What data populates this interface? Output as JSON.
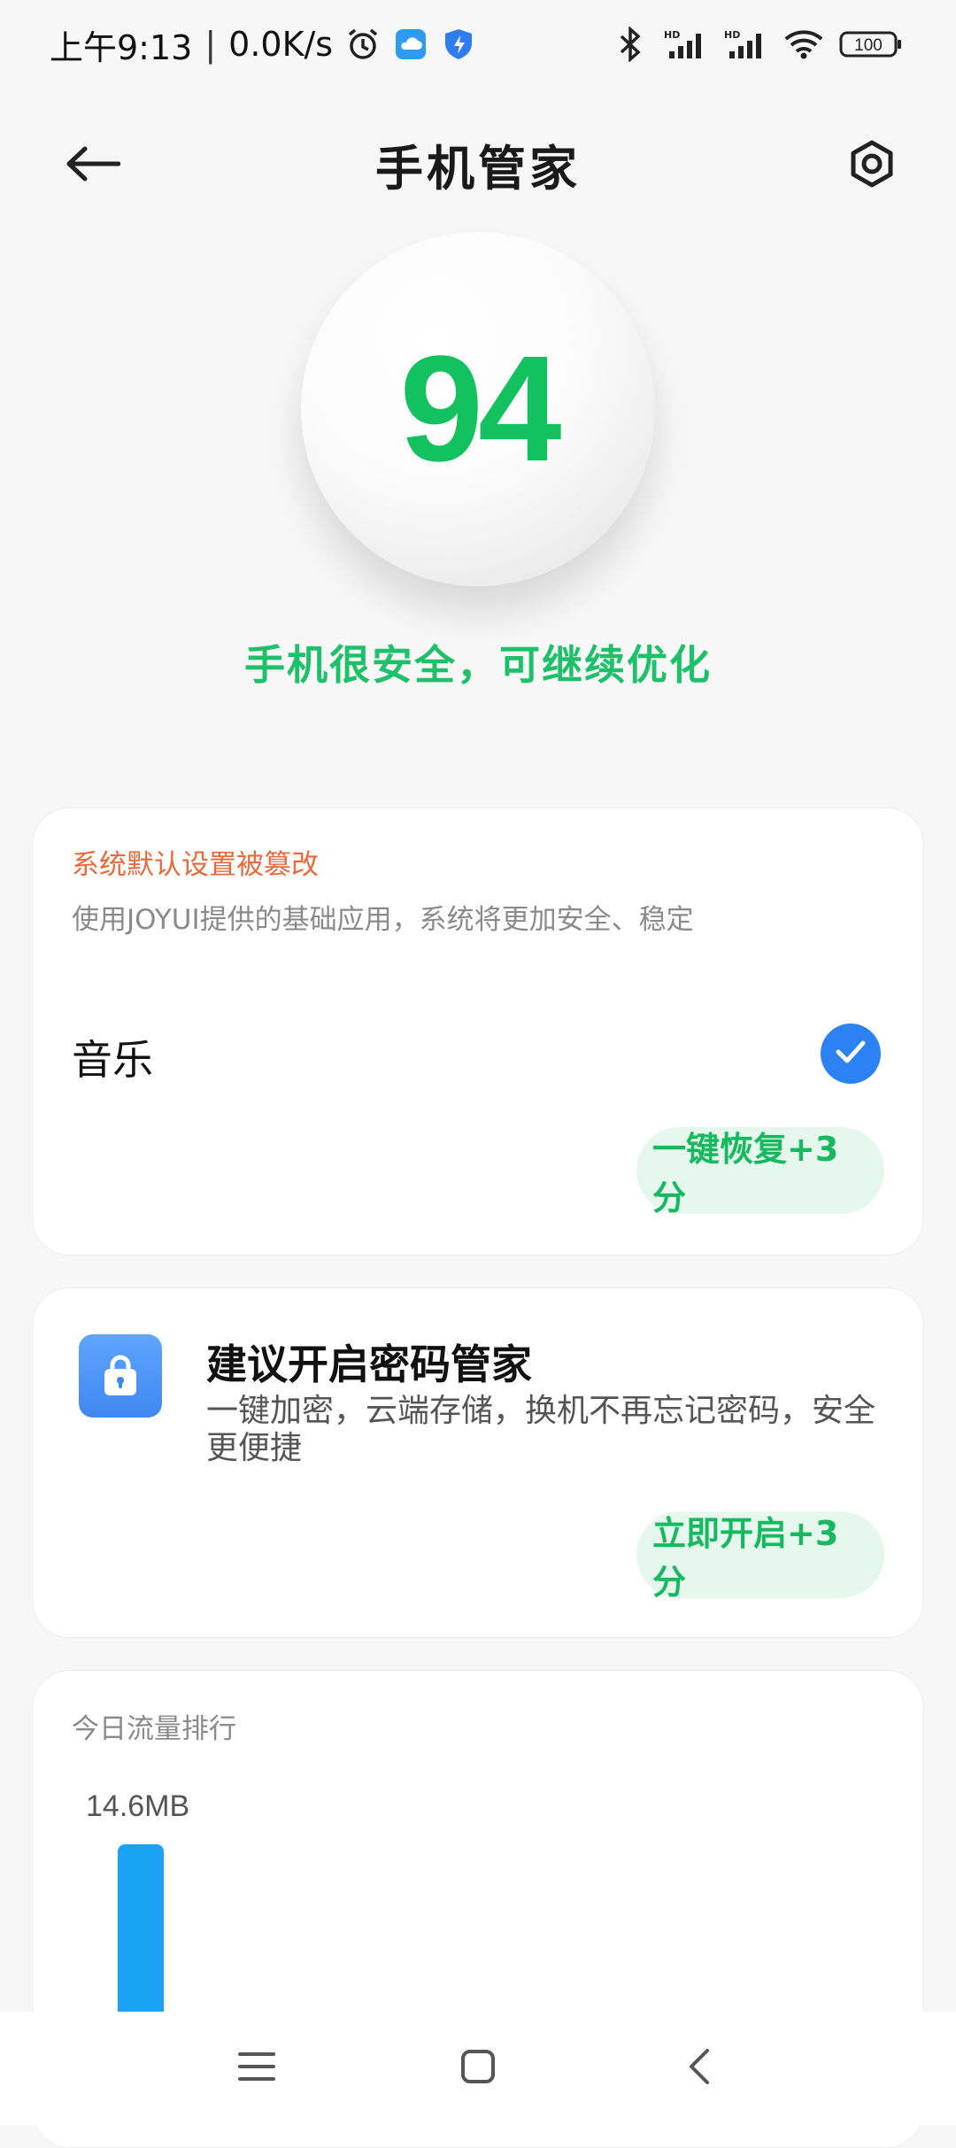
{
  "status_bar": {
    "time": "上午9:13",
    "net_speed": "0.0K/s",
    "battery": "100",
    "icons": [
      "alarm-icon",
      "cloud-icon",
      "shield-icon",
      "bluetooth-icon",
      "signal-icon",
      "signal-icon",
      "wifi-icon",
      "battery-icon"
    ]
  },
  "header": {
    "title": "手机管家",
    "back_icon": "back-arrow-icon",
    "settings_icon": "settings-icon"
  },
  "score": {
    "value": "94",
    "message": "手机很安全，可继续优化",
    "color": "#13c25e"
  },
  "default_settings_card": {
    "warning_title": "系统默认设置被篡改",
    "description": "使用JOYUI提供的基础应用，系统将更加安全、稳定",
    "app_name": "音乐",
    "checked": true,
    "action_label": "一键恢复+3分"
  },
  "password_card": {
    "icon": "lock-icon",
    "title": "建议开启密码管家",
    "description": "一键加密，云端存储，换机不再忘记密码，安全更便捷",
    "action_label": "立即开启+3分"
  },
  "traffic_card": {
    "title": "今日流量排行",
    "top_value": "14.6MB"
  },
  "nav_bar": {
    "icons": [
      "menu-icon",
      "home-icon",
      "back-icon"
    ]
  },
  "colors": {
    "accent_green": "#1ec169",
    "warning": "#e86a3a",
    "check_blue": "#2c82f2",
    "bar_blue": "#1aa3f5"
  }
}
